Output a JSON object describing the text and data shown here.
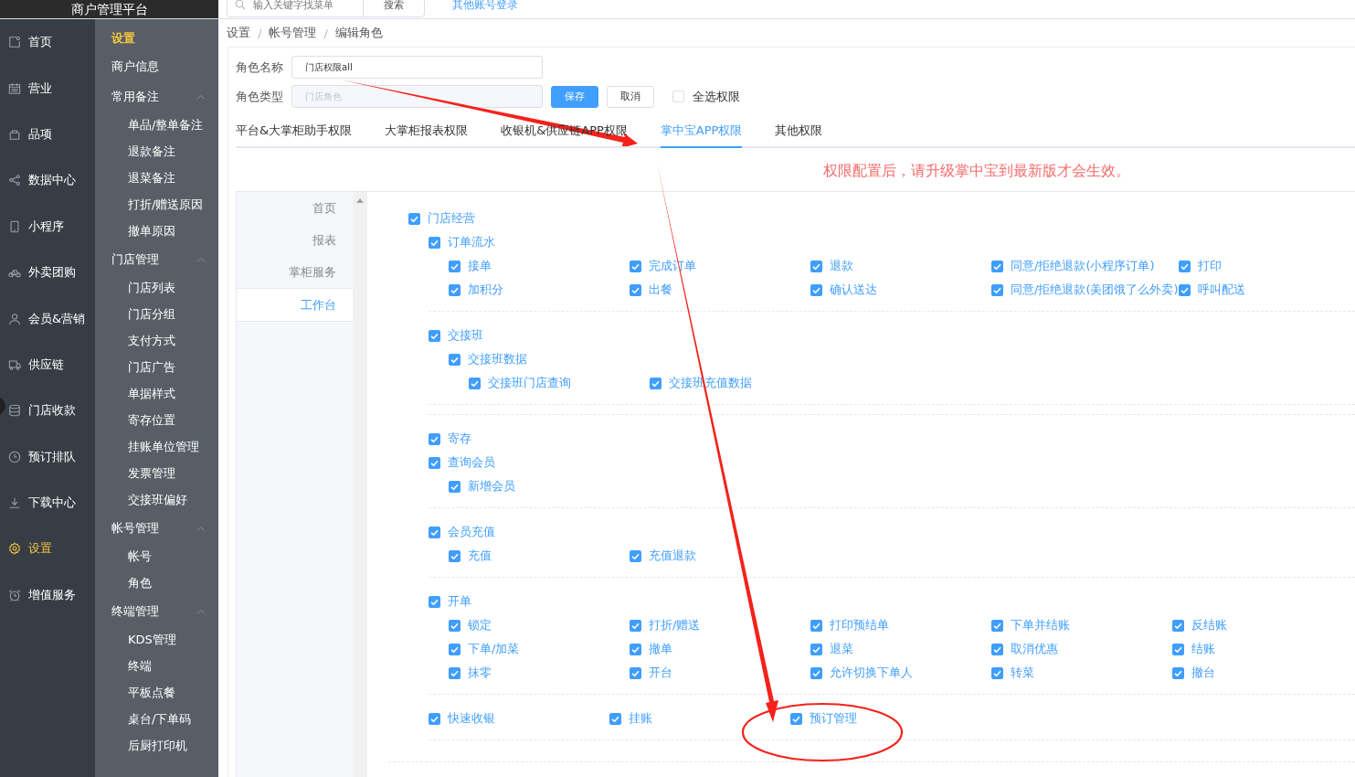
{
  "header": {
    "title": "商户管理平台",
    "search_placeholder": "输入关键字找菜单",
    "search_button": "搜索",
    "link": "其他账号登录"
  },
  "nav": [
    {
      "label": "首页",
      "selected": false
    },
    {
      "label": "营业",
      "selected": false
    },
    {
      "label": "品项",
      "selected": false
    },
    {
      "label": "数据中心",
      "selected": false
    },
    {
      "label": "小程序",
      "selected": false
    },
    {
      "label": "外卖团购",
      "selected": false
    },
    {
      "label": "会员&营销",
      "selected": false
    },
    {
      "label": "供应链",
      "selected": false
    },
    {
      "label": "门店收款",
      "selected": false
    },
    {
      "label": "预订排队",
      "selected": false
    },
    {
      "label": "下载中心",
      "selected": false
    },
    {
      "label": "设置",
      "selected": true
    },
    {
      "label": "增值服务",
      "selected": false
    }
  ],
  "submenu": {
    "title": "设置",
    "items": [
      {
        "label": "商户信息"
      },
      {
        "label": "常用备注",
        "expanded": true,
        "children": [
          "单品/整单备注",
          "退款备注",
          "退菜备注",
          "打折/赠送原因",
          "撤单原因"
        ]
      },
      {
        "label": "门店管理",
        "expanded": true,
        "children": [
          "门店列表",
          "门店分组",
          "支付方式",
          "门店广告",
          "单据样式",
          "寄存位置",
          "挂账单位管理",
          "发票管理",
          "交接班偏好"
        ]
      },
      {
        "label": "帐号管理",
        "expanded": true,
        "children": [
          "帐号",
          "角色"
        ]
      },
      {
        "label": "终端管理",
        "expanded": true,
        "children": [
          "KDS管理",
          "终端",
          "平板点餐",
          "桌台/下单码",
          "后厨打印机"
        ]
      }
    ]
  },
  "breadcrumb": {
    "separator": "/",
    "items": [
      "设置",
      "帐号管理",
      "编辑角色"
    ]
  },
  "form": {
    "name_label": "角色名称",
    "name_value": "门店权限all",
    "type_label": "角色类型",
    "type_value": "门店角色",
    "type_disabled": true,
    "save": "保存",
    "cancel": "取消",
    "select_all": {
      "label": "全选权限",
      "checked": false
    }
  },
  "tabs": [
    {
      "label": "平台&大掌柜助手权限",
      "selected": false
    },
    {
      "label": "大掌柜报表权限",
      "selected": false
    },
    {
      "label": "收银机&供应链APP权限",
      "selected": false
    },
    {
      "label": "掌中宝APP权限",
      "selected": true
    },
    {
      "label": "其他权限",
      "selected": false
    }
  ],
  "notice": "权限配置后，请升级掌中宝到最新版才会生效。",
  "side_tabs": [
    {
      "label": "首页",
      "selected": false
    },
    {
      "label": "报表",
      "selected": false
    },
    {
      "label": "掌柜服务",
      "selected": false
    },
    {
      "label": "工作台",
      "selected": true
    }
  ],
  "permissions": {
    "label": "门店经营",
    "checked": true,
    "groups": [
      [
        {
          "label": "订单流水",
          "checked": true,
          "children": [
            {
              "label": "接单",
              "checked": true
            },
            {
              "label": "完成订单",
              "checked": true
            },
            {
              "label": "退款",
              "checked": true
            },
            {
              "label": "同意/拒绝退款(小程序订单)",
              "checked": true
            },
            {
              "label": "打印",
              "checked": true
            },
            {
              "label": "加积分",
              "checked": true
            },
            {
              "label": "出餐",
              "checked": true
            },
            {
              "label": "确认送达",
              "checked": true
            },
            {
              "label": "同意/拒绝退款(美团饿了么外卖)",
              "checked": true
            },
            {
              "label": "呼叫配送",
              "checked": true
            }
          ]
        }
      ],
      [
        {
          "label": "交接班",
          "checked": true,
          "children": [
            {
              "label": "交接班数据",
              "checked": true,
              "children": [
                {
                  "label": "交接班门店查询",
                  "checked": true
                },
                {
                  "label": "交接班充值数据",
                  "checked": true
                }
              ]
            }
          ]
        }
      ],
      [
        {
          "label": "寄存",
          "checked": true
        },
        {
          "label": "查询会员",
          "checked": true,
          "children": [
            {
              "label": "新增会员",
              "checked": true
            }
          ]
        }
      ],
      [
        {
          "label": "会员充值",
          "checked": true,
          "children": [
            {
              "label": "充值",
              "checked": true
            },
            {
              "label": "充值退款",
              "checked": true
            }
          ]
        }
      ],
      [
        {
          "label": "开单",
          "checked": true,
          "children": [
            {
              "label": "锁定",
              "checked": true
            },
            {
              "label": "打折/赠送",
              "checked": true
            },
            {
              "label": "打印预结单",
              "checked": true
            },
            {
              "label": "下单并结账",
              "checked": true
            },
            {
              "label": "反结账",
              "checked": true
            },
            {
              "label": "下单/加菜",
              "checked": true
            },
            {
              "label": "撤单",
              "checked": true
            },
            {
              "label": "退菜",
              "checked": true
            },
            {
              "label": "取消优惠",
              "checked": true
            },
            {
              "label": "结账",
              "checked": true
            },
            {
              "label": "抹零",
              "checked": true
            },
            {
              "label": "开台",
              "checked": true
            },
            {
              "label": "允许切换下单人",
              "checked": true
            },
            {
              "label": "转菜",
              "checked": true
            },
            {
              "label": "撤台",
              "checked": true
            }
          ]
        }
      ],
      [
        {
          "label": "快速收银",
          "checked": true
        },
        {
          "label": "挂账",
          "checked": true
        },
        {
          "label": "预订管理",
          "checked": true
        }
      ]
    ]
  }
}
